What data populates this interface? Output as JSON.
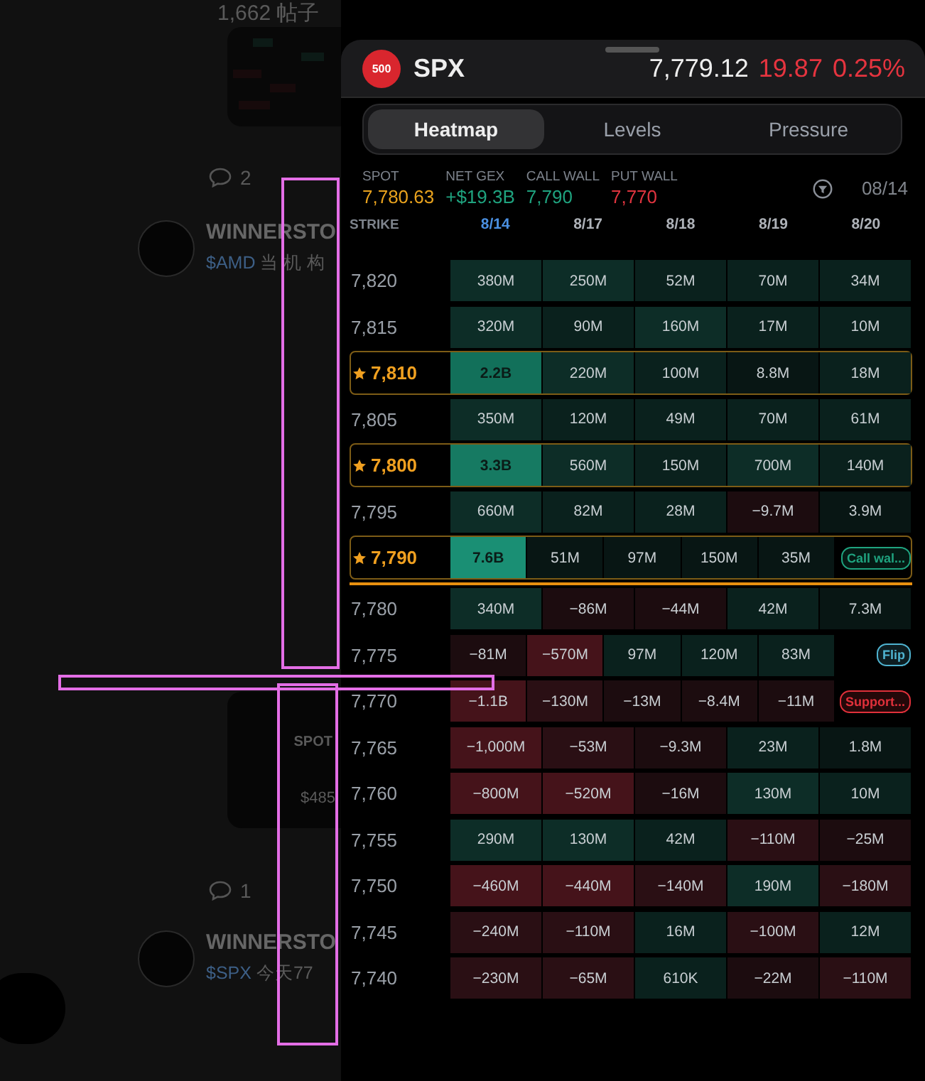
{
  "feed": {
    "post_count": "1,662 帖子",
    "comments_a": "2",
    "post_a": {
      "author": "WINNERSTO",
      "ticker": "$AMD",
      "text": "当机构"
    },
    "card_a": {
      "column_1": "SPOT",
      "value_1": "$485"
    },
    "comments_b": "1",
    "post_b": {
      "author": "WINNERSTO",
      "ticker": "$SPX",
      "text": "今天77"
    }
  },
  "header": {
    "logo": "500",
    "symbol": "SPX",
    "price": "7,779.12",
    "change": "19.87",
    "change_pct": "0.25%"
  },
  "tabs": [
    {
      "label": "Heatmap",
      "selected": true
    },
    {
      "label": "Levels",
      "selected": false
    },
    {
      "label": "Pressure",
      "selected": false
    }
  ],
  "stats": [
    {
      "label": "SPOT",
      "value": "7,780.63",
      "color": "#e8a21e"
    },
    {
      "label": "NET GEX",
      "value": "+$19.3B",
      "color": "#1fa37f"
    },
    {
      "label": "CALL WALL",
      "value": "7,790",
      "color": "#1fa37f"
    },
    {
      "label": "PUT WALL",
      "value": "7,770",
      "color": "#e0343f"
    }
  ],
  "date": "08/14",
  "columns": {
    "strike": "STRIKE",
    "dates": [
      {
        "label": "8/14",
        "selected": true
      },
      {
        "label": "8/17",
        "selected": false
      },
      {
        "label": "8/18",
        "selected": false
      },
      {
        "label": "8/19",
        "selected": false
      },
      {
        "label": "8/20",
        "selected": false
      }
    ]
  },
  "rows": [
    {
      "kind": "strike",
      "strike": "7,820",
      "starred": false,
      "cells": [
        {
          "kind": "value",
          "text": "380M",
          "color": "#0d2d27"
        },
        {
          "kind": "value",
          "text": "250M",
          "color": "#0d2d27"
        },
        {
          "kind": "value",
          "text": "52M",
          "color": "#0a211d"
        },
        {
          "kind": "value",
          "text": "70M",
          "color": "#0a211d"
        },
        {
          "kind": "value",
          "text": "34M",
          "color": "#0a211d"
        }
      ]
    },
    {
      "kind": "strike",
      "strike": "7,815",
      "starred": false,
      "cells": [
        {
          "kind": "value",
          "text": "320M",
          "color": "#0d2d27"
        },
        {
          "kind": "value",
          "text": "90M",
          "color": "#0a211d"
        },
        {
          "kind": "value",
          "text": "160M",
          "color": "#0d2d27"
        },
        {
          "kind": "value",
          "text": "17M",
          "color": "#0a211d"
        },
        {
          "kind": "value",
          "text": "10M",
          "color": "#0a211d"
        }
      ]
    },
    {
      "kind": "strike",
      "strike": "7,810",
      "starred": true,
      "cells": [
        {
          "kind": "peak",
          "text": "2.2B",
          "color": "#12705a"
        },
        {
          "kind": "value",
          "text": "220M",
          "color": "#0d2d27"
        },
        {
          "kind": "value",
          "text": "100M",
          "color": "#0a211d"
        },
        {
          "kind": "value",
          "text": "8.8M",
          "color": "#081614"
        },
        {
          "kind": "value",
          "text": "18M",
          "color": "#0a211d"
        }
      ]
    },
    {
      "kind": "strike",
      "strike": "7,805",
      "starred": false,
      "cells": [
        {
          "kind": "value",
          "text": "350M",
          "color": "#0d2d27"
        },
        {
          "kind": "value",
          "text": "120M",
          "color": "#0a211d"
        },
        {
          "kind": "value",
          "text": "49M",
          "color": "#0a211d"
        },
        {
          "kind": "value",
          "text": "70M",
          "color": "#0a211d"
        },
        {
          "kind": "value",
          "text": "61M",
          "color": "#0a211d"
        }
      ]
    },
    {
      "kind": "strike",
      "strike": "7,800",
      "starred": true,
      "cells": [
        {
          "kind": "peak",
          "text": "3.3B",
          "color": "#167a62"
        },
        {
          "kind": "value",
          "text": "560M",
          "color": "#0d2d27"
        },
        {
          "kind": "value",
          "text": "150M",
          "color": "#0a211d"
        },
        {
          "kind": "value",
          "text": "700M",
          "color": "#0d2d27"
        },
        {
          "kind": "value",
          "text": "140M",
          "color": "#0a211d"
        }
      ]
    },
    {
      "kind": "strike",
      "strike": "7,795",
      "starred": false,
      "cells": [
        {
          "kind": "value",
          "text": "660M",
          "color": "#0d2d27"
        },
        {
          "kind": "value",
          "text": "82M",
          "color": "#0a211d"
        },
        {
          "kind": "value",
          "text": "28M",
          "color": "#0a211d"
        },
        {
          "kind": "value",
          "text": "−9.7M",
          "color": "#1c0c0f"
        },
        {
          "kind": "value",
          "text": "3.9M",
          "color": "#081614"
        }
      ]
    },
    {
      "kind": "strike",
      "strike": "7,790",
      "starred": true,
      "cells": [
        {
          "kind": "peak",
          "text": "7.6B",
          "color": "#1a8f74"
        },
        {
          "kind": "value",
          "text": "51M",
          "color": "#081614"
        },
        {
          "kind": "value",
          "text": "97M",
          "color": "#081614"
        },
        {
          "kind": "value",
          "text": "150M",
          "color": "#081614"
        },
        {
          "kind": "value",
          "text": "35M",
          "color": "#081614"
        },
        {
          "kind": "tag",
          "text": "Call wal...",
          "color": "#1fa37f"
        }
      ]
    },
    {
      "kind": "spot_line"
    },
    {
      "kind": "strike",
      "strike": "7,780",
      "starred": false,
      "cells": [
        {
          "kind": "value",
          "text": "340M",
          "color": "#0d2d27"
        },
        {
          "kind": "value",
          "text": "−86M",
          "color": "#1c0c0f"
        },
        {
          "kind": "value",
          "text": "−44M",
          "color": "#1c0c0f"
        },
        {
          "kind": "value",
          "text": "42M",
          "color": "#0a211d"
        },
        {
          "kind": "value",
          "text": "7.3M",
          "color": "#081614"
        }
      ]
    },
    {
      "kind": "strike",
      "strike": "7,775",
      "starred": false,
      "cells": [
        {
          "kind": "value",
          "text": "−81M",
          "color": "#1c0c0f"
        },
        {
          "kind": "value",
          "text": "−570M",
          "color": "#45131a"
        },
        {
          "kind": "value",
          "text": "97M",
          "color": "#0a211d"
        },
        {
          "kind": "value",
          "text": "120M",
          "color": "#0a211d"
        },
        {
          "kind": "value",
          "text": "83M",
          "color": "#0a211d"
        },
        {
          "kind": "tag",
          "text": "Flip",
          "color": "#4fb3d0"
        }
      ]
    },
    {
      "kind": "strike",
      "strike": "7,770",
      "starred": false,
      "cells": [
        {
          "kind": "value",
          "text": "−1.1B",
          "color": "#45131a"
        },
        {
          "kind": "value",
          "text": "−130M",
          "color": "#2a0f14"
        },
        {
          "kind": "value",
          "text": "−13M",
          "color": "#1c0c0f"
        },
        {
          "kind": "value",
          "text": "−8.4M",
          "color": "#1c0c0f"
        },
        {
          "kind": "value",
          "text": "−11M",
          "color": "#1c0c0f"
        },
        {
          "kind": "tag",
          "text": "Support...",
          "color": "#e0303a"
        }
      ]
    },
    {
      "kind": "strike",
      "strike": "7,765",
      "starred": false,
      "cells": [
        {
          "kind": "value",
          "text": "−1,000M",
          "color": "#45131a"
        },
        {
          "kind": "value",
          "text": "−53M",
          "color": "#2a0f14"
        },
        {
          "kind": "value",
          "text": "−9.3M",
          "color": "#1c0c0f"
        },
        {
          "kind": "value",
          "text": "23M",
          "color": "#0a211d"
        },
        {
          "kind": "value",
          "text": "1.8M",
          "color": "#081614"
        }
      ]
    },
    {
      "kind": "strike",
      "strike": "7,760",
      "starred": false,
      "cells": [
        {
          "kind": "value",
          "text": "−800M",
          "color": "#45131a"
        },
        {
          "kind": "value",
          "text": "−520M",
          "color": "#45131a"
        },
        {
          "kind": "value",
          "text": "−16M",
          "color": "#1c0c0f"
        },
        {
          "kind": "value",
          "text": "130M",
          "color": "#0d2d27"
        },
        {
          "kind": "value",
          "text": "10M",
          "color": "#0a211d"
        }
      ]
    },
    {
      "kind": "strike",
      "strike": "7,755",
      "starred": false,
      "cells": [
        {
          "kind": "value",
          "text": "290M",
          "color": "#0d2d27"
        },
        {
          "kind": "value",
          "text": "130M",
          "color": "#0d2d27"
        },
        {
          "kind": "value",
          "text": "42M",
          "color": "#0a211d"
        },
        {
          "kind": "value",
          "text": "−110M",
          "color": "#2a0f14"
        },
        {
          "kind": "value",
          "text": "−25M",
          "color": "#1c0c0f"
        }
      ]
    },
    {
      "kind": "strike",
      "strike": "7,750",
      "starred": false,
      "cells": [
        {
          "kind": "value",
          "text": "−460M",
          "color": "#45131a"
        },
        {
          "kind": "value",
          "text": "−440M",
          "color": "#45131a"
        },
        {
          "kind": "value",
          "text": "−140M",
          "color": "#2a0f14"
        },
        {
          "kind": "value",
          "text": "190M",
          "color": "#0d2d27"
        },
        {
          "kind": "value",
          "text": "−180M",
          "color": "#2a0f14"
        }
      ]
    },
    {
      "kind": "strike",
      "strike": "7,745",
      "starred": false,
      "cells": [
        {
          "kind": "value",
          "text": "−240M",
          "color": "#2a0f14"
        },
        {
          "kind": "value",
          "text": "−110M",
          "color": "#2a0f14"
        },
        {
          "kind": "value",
          "text": "16M",
          "color": "#0a211d"
        },
        {
          "kind": "value",
          "text": "−100M",
          "color": "#2a0f14"
        },
        {
          "kind": "value",
          "text": "12M",
          "color": "#0a211d"
        }
      ]
    },
    {
      "kind": "strike",
      "strike": "7,740",
      "starred": false,
      "cells": [
        {
          "kind": "value",
          "text": "−230M",
          "color": "#2a0f14"
        },
        {
          "kind": "value",
          "text": "−65M",
          "color": "#2a0f14"
        },
        {
          "kind": "value",
          "text": "610K",
          "color": "#0a211d"
        },
        {
          "kind": "value",
          "text": "−22M",
          "color": "#1c0c0f"
        },
        {
          "kind": "value",
          "text": "−110M",
          "color": "#2a0f14"
        }
      ]
    }
  ]
}
